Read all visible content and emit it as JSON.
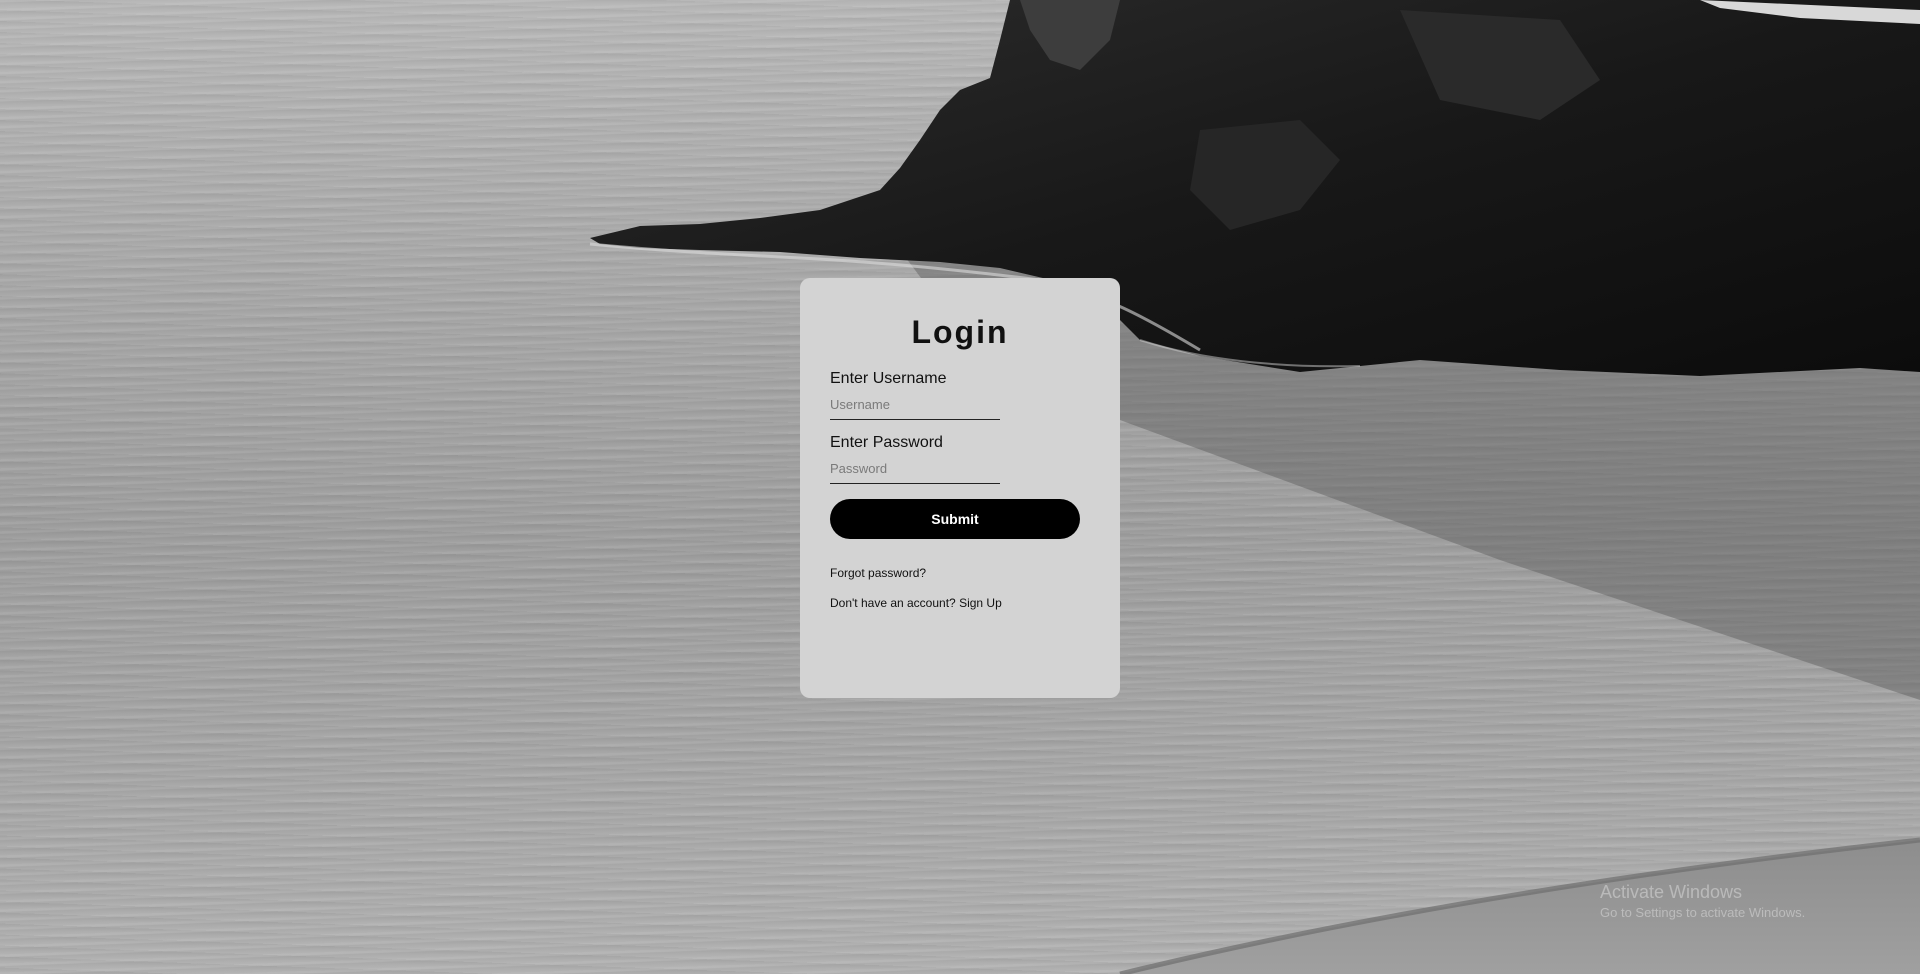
{
  "login": {
    "title": "Login",
    "username_label": "Enter Username",
    "username_placeholder": "Username",
    "username_value": "",
    "password_label": "Enter Password",
    "password_placeholder": "Password",
    "password_value": "",
    "submit_label": "Submit",
    "forgot_link": "Forgot password?",
    "account_prompt": "Don't have an account?",
    "signup_link": "Sign Up"
  },
  "watermark": {
    "title": "Activate Windows",
    "subtitle": "Go to Settings to activate Windows."
  },
  "colors": {
    "card_background": "#d3d3d3",
    "button_background": "#000000",
    "button_text": "#ffffff"
  }
}
